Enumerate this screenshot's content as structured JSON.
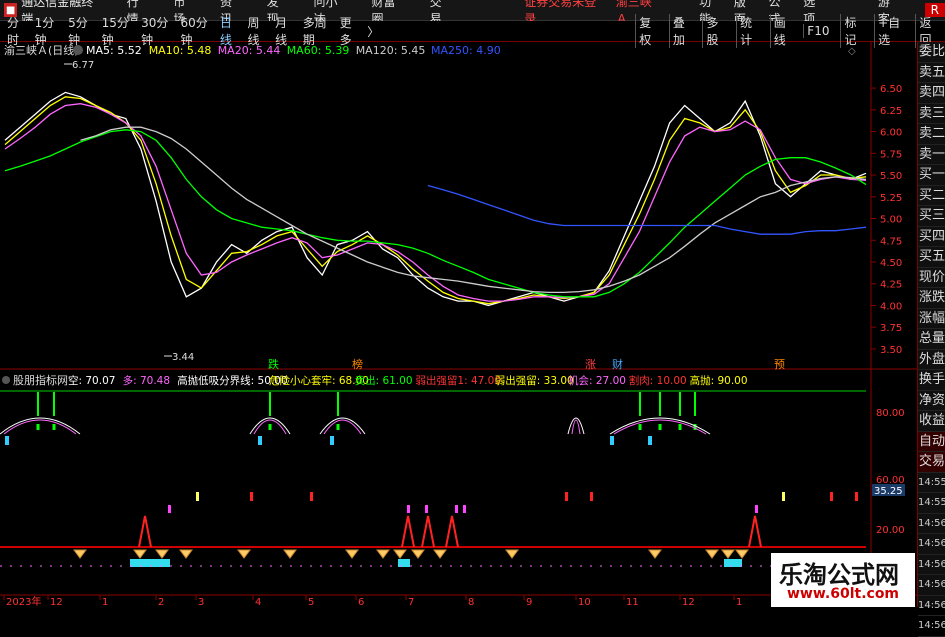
{
  "menubar": {
    "app_title": "通达信金融终端",
    "items": [
      "行情",
      "市场",
      "资讯",
      "发现",
      "问小达",
      "财富圈",
      "交易"
    ],
    "warning": "证券交易未登录",
    "stock_name": "渝三峡Ａ",
    "right_items": [
      "功能",
      "版面",
      "公式",
      "选项"
    ],
    "right_extra": "游客",
    "r_badge": "R"
  },
  "periodbar": {
    "periods": [
      "分时",
      "1分钟",
      "5分钟",
      "15分钟",
      "30分钟",
      "60分钟",
      "日线",
      "周线",
      "月线",
      "多周期",
      "更多"
    ],
    "selected": "日线",
    "more_arrow": "〉",
    "tools": [
      "复权",
      "叠加",
      "多股",
      "统计",
      "画线",
      "F10",
      "标记",
      "+自选",
      "返回"
    ]
  },
  "sidebar": {
    "items": [
      "委比",
      "卖五",
      "卖四",
      "卖三",
      "卖二",
      "卖一",
      "买一",
      "买二",
      "买三",
      "买四",
      "买五",
      "现价",
      "涨跌",
      "涨幅",
      "总量",
      "外盘",
      "换手",
      "净资",
      "收益",
      "自动",
      "交易"
    ],
    "times": [
      "14:55",
      "14:55",
      "14:56",
      "14:56",
      "14:56",
      "14:56",
      "14:56",
      "14:56"
    ]
  },
  "main_chart": {
    "title": "渝三峡Ａ(日线)",
    "ma_legend": [
      {
        "label": "MA5: 5.52",
        "color": "#ffffff"
      },
      {
        "label": "MA10: 5.48",
        "color": "#ffff00"
      },
      {
        "label": "MA20: 5.44",
        "color": "#ff66ff"
      },
      {
        "label": "MA60: 5.39",
        "color": "#00ff00"
      },
      {
        "label": "MA120: 5.45",
        "color": "#cccccc"
      },
      {
        "label": "MA250: 4.90",
        "color": "#3355ff"
      }
    ],
    "high_label": "6.77",
    "low_label": "3.44",
    "y_ticks": [
      "6.50",
      "6.25",
      "6.00",
      "5.75",
      "5.50",
      "5.25",
      "5.00",
      "4.75",
      "4.50",
      "4.25",
      "4.00",
      "3.75",
      "3.50"
    ],
    "markers": [
      {
        "text": "跌",
        "color": "#00ff00"
      },
      {
        "text": "榜",
        "color": "#ff8800"
      },
      {
        "text": "涨",
        "color": "#ff4444"
      },
      {
        "text": "财",
        "color": "#44aaff"
      },
      {
        "text": "预",
        "color": "#ff8800"
      }
    ]
  },
  "indicator": {
    "name": "股朋指标网",
    "legend": [
      {
        "label": "空: 70.07",
        "color": "#ffffff"
      },
      {
        "label": "多: 70.48",
        "color": "#ff66ff"
      },
      {
        "label": "高抛低吸分界线: 50.00",
        "color": "#ffffff"
      },
      {
        "label": "危险小心套牢: 68.00",
        "color": "#ffff00"
      },
      {
        "label": "卖出: 61.00",
        "color": "#00ff00"
      },
      {
        "label": "弱出强留1: 47.00",
        "color": "#ff3333"
      },
      {
        "label": "弱出强留: 33.00",
        "color": "#ffff00"
      },
      {
        "label": "机会: 27.00",
        "color": "#ff66ff"
      },
      {
        "label": "割肉: 10.00",
        "color": "#ff3333"
      },
      {
        "label": "高抛: 90.00",
        "color": "#ffff00"
      }
    ],
    "y_ticks": [
      "80.00",
      "60.00",
      "20.00"
    ],
    "current_value": "35.25"
  },
  "x_axis": {
    "labels": [
      "2023年",
      "12",
      "1",
      "2",
      "3",
      "4",
      "5",
      "6",
      "7",
      "8",
      "9",
      "10",
      "11",
      "12",
      "1"
    ]
  },
  "watermark": {
    "line1": "乐淘公式网",
    "line2": "www.60lt.com"
  },
  "chart_data": {
    "type": "line",
    "title": "渝三峡Ａ(日线)",
    "ylim": [
      3.35,
      6.8
    ],
    "x_count": 58,
    "series": [
      {
        "name": "MA5",
        "color": "#ffffff",
        "values": [
          5.9,
          6.05,
          6.2,
          6.35,
          6.45,
          6.4,
          6.3,
          6.2,
          6.15,
          5.8,
          5.2,
          4.5,
          4.1,
          4.2,
          4.5,
          4.7,
          4.6,
          4.75,
          4.85,
          4.9,
          4.55,
          4.35,
          4.7,
          4.75,
          4.85,
          4.65,
          4.55,
          4.35,
          4.2,
          4.1,
          4.05,
          4.05,
          4.0,
          4.05,
          4.1,
          4.15,
          4.1,
          4.05,
          4.1,
          4.15,
          4.4,
          4.8,
          5.2,
          5.6,
          6.1,
          6.3,
          6.15,
          6.0,
          6.1,
          6.35,
          5.95,
          5.4,
          5.25,
          5.4,
          5.55,
          5.5,
          5.45,
          5.52
        ]
      },
      {
        "name": "MA10",
        "color": "#ffff00",
        "values": [
          5.85,
          6.0,
          6.15,
          6.3,
          6.4,
          6.38,
          6.3,
          6.22,
          6.1,
          5.9,
          5.4,
          4.8,
          4.3,
          4.2,
          4.4,
          4.6,
          4.62,
          4.7,
          4.8,
          4.85,
          4.65,
          4.45,
          4.62,
          4.7,
          4.8,
          4.7,
          4.58,
          4.42,
          4.28,
          4.15,
          4.08,
          4.05,
          4.02,
          4.05,
          4.08,
          4.12,
          4.1,
          4.08,
          4.1,
          4.15,
          4.35,
          4.7,
          5.05,
          5.45,
          5.9,
          6.15,
          6.1,
          6.0,
          6.05,
          6.25,
          6.0,
          5.55,
          5.3,
          5.38,
          5.5,
          5.5,
          5.46,
          5.48
        ]
      },
      {
        "name": "MA20",
        "color": "#ff66ff",
        "values": [
          5.8,
          5.92,
          6.05,
          6.2,
          6.3,
          6.32,
          6.28,
          6.2,
          6.1,
          5.95,
          5.6,
          5.1,
          4.6,
          4.35,
          4.38,
          4.5,
          4.58,
          4.65,
          4.72,
          4.78,
          4.72,
          4.55,
          4.58,
          4.65,
          4.72,
          4.7,
          4.62,
          4.5,
          4.35,
          4.22,
          4.12,
          4.08,
          4.05,
          4.05,
          4.07,
          4.1,
          4.1,
          4.09,
          4.1,
          4.13,
          4.25,
          4.55,
          4.85,
          5.25,
          5.65,
          5.95,
          6.05,
          6.0,
          6.02,
          6.12,
          6.02,
          5.7,
          5.45,
          5.4,
          5.45,
          5.48,
          5.45,
          5.44
        ]
      },
      {
        "name": "MA60",
        "color": "#00ff00",
        "values": [
          5.55,
          5.6,
          5.66,
          5.72,
          5.8,
          5.88,
          5.94,
          6.0,
          6.02,
          6.0,
          5.9,
          5.7,
          5.45,
          5.25,
          5.1,
          5.0,
          4.95,
          4.9,
          4.88,
          4.86,
          4.82,
          4.78,
          4.75,
          4.74,
          4.74,
          4.72,
          4.7,
          4.66,
          4.6,
          4.52,
          4.45,
          4.38,
          4.3,
          4.25,
          4.2,
          4.15,
          4.12,
          4.1,
          4.1,
          4.1,
          4.15,
          4.25,
          4.38,
          4.55,
          4.72,
          4.9,
          5.05,
          5.2,
          5.35,
          5.5,
          5.6,
          5.68,
          5.7,
          5.7,
          5.65,
          5.58,
          5.5,
          5.39
        ]
      },
      {
        "name": "MA120",
        "color": "#cccccc",
        "values": [
          null,
          null,
          null,
          null,
          null,
          5.9,
          5.95,
          6.02,
          6.05,
          6.05,
          6.0,
          5.92,
          5.8,
          5.65,
          5.5,
          5.35,
          5.22,
          5.12,
          5.02,
          4.92,
          4.82,
          4.74,
          4.66,
          4.58,
          4.5,
          4.44,
          4.38,
          4.34,
          4.32,
          4.3,
          4.28,
          4.25,
          4.22,
          4.2,
          4.18,
          4.16,
          4.15,
          4.15,
          4.16,
          4.18,
          4.22,
          4.28,
          4.35,
          4.45,
          4.55,
          4.68,
          4.82,
          4.95,
          5.05,
          5.15,
          5.25,
          5.3,
          5.38,
          5.42,
          5.46,
          5.48,
          5.47,
          5.45
        ]
      },
      {
        "name": "MA250",
        "color": "#3355ff",
        "values": [
          null,
          null,
          null,
          null,
          null,
          null,
          null,
          null,
          null,
          null,
          null,
          null,
          null,
          null,
          null,
          null,
          null,
          null,
          null,
          null,
          null,
          null,
          null,
          null,
          null,
          null,
          null,
          null,
          5.38,
          5.33,
          5.28,
          5.22,
          5.16,
          5.1,
          5.04,
          4.98,
          4.94,
          4.92,
          4.92,
          4.92,
          4.92,
          4.92,
          4.92,
          4.92,
          4.92,
          4.92,
          4.92,
          4.92,
          4.88,
          4.85,
          4.82,
          4.82,
          4.82,
          4.85,
          4.86,
          4.86,
          4.88,
          4.9
        ]
      }
    ]
  }
}
